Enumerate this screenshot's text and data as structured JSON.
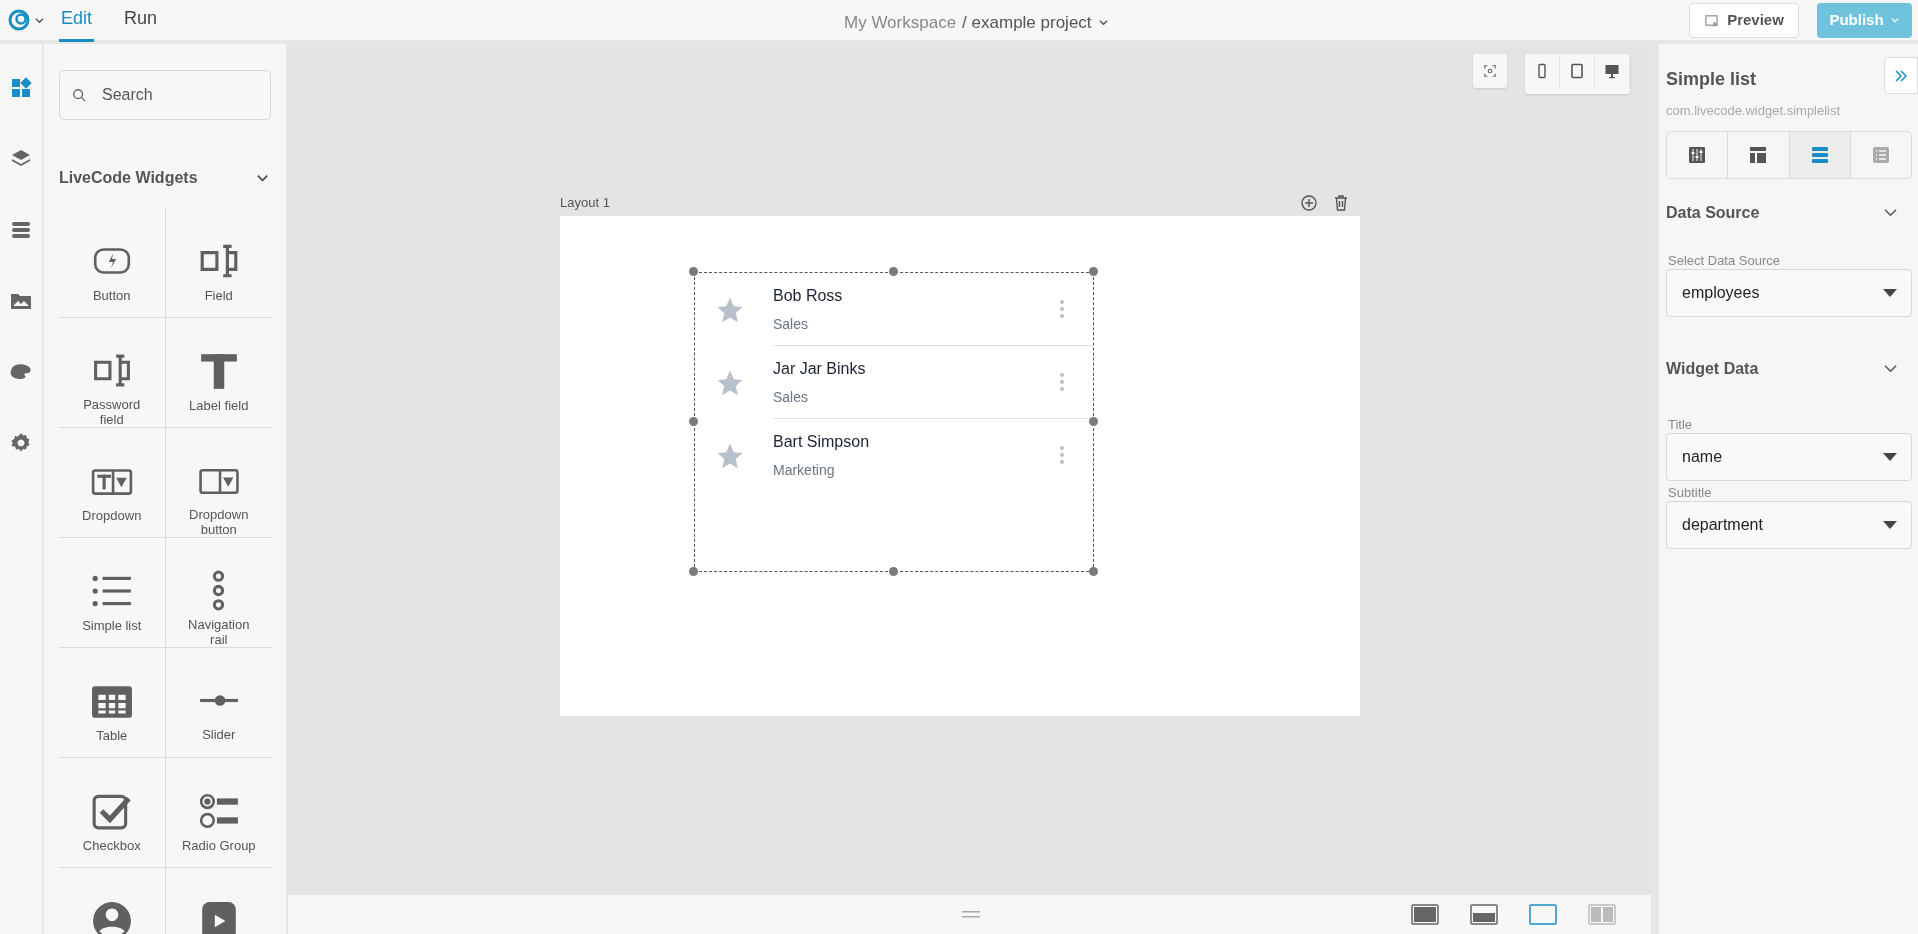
{
  "top_bar": {
    "mode_tabs": [
      {
        "label": "Edit",
        "selected": true
      },
      {
        "label": "Run",
        "selected": false
      }
    ],
    "breadcrumb": {
      "workspace": "My Workspace",
      "project": "/ example project"
    },
    "buttons": [
      {
        "kind": "preview",
        "label": "Preview"
      },
      {
        "kind": "publish",
        "label": "Publish"
      }
    ]
  },
  "rail": [
    {
      "kind": "widgets",
      "selected": true
    },
    {
      "kind": "layers",
      "selected": false
    },
    {
      "kind": "data",
      "selected": false
    },
    {
      "kind": "media",
      "selected": false
    },
    {
      "kind": "themes",
      "selected": false
    },
    {
      "kind": "settings",
      "selected": false
    }
  ],
  "widget_panel": {
    "search": {
      "placeholder": "Search"
    },
    "section": "LiveCode Widgets",
    "widgets": [
      {
        "kind": "button",
        "label": "Button"
      },
      {
        "kind": "field",
        "label": "Field"
      },
      {
        "kind": "password",
        "label": "Password field"
      },
      {
        "kind": "label",
        "label": "Label field"
      },
      {
        "kind": "dropdown",
        "label": "Dropdown"
      },
      {
        "kind": "dropdown_button",
        "label": "Dropdown button"
      },
      {
        "kind": "list",
        "label": "Simple list"
      },
      {
        "kind": "navrail",
        "label": "Navigation rail"
      },
      {
        "kind": "table",
        "label": "Table"
      },
      {
        "kind": "slider",
        "label": "Slider"
      },
      {
        "kind": "checkbox",
        "label": "Checkbox"
      },
      {
        "kind": "radio",
        "label": "Radio Group"
      },
      {
        "kind": "avatar"
      },
      {
        "kind": "video"
      }
    ]
  },
  "canvas": {
    "device_buttons": [
      {
        "kind": "phone"
      },
      {
        "kind": "tablet"
      },
      {
        "kind": "desktop"
      }
    ],
    "layout": {
      "title": "Layout 1",
      "list_items": [
        {
          "title": "Bob Ross",
          "subtitle": "Sales"
        },
        {
          "title": "Jar Jar Binks",
          "subtitle": "Sales"
        },
        {
          "title": "Bart Simpson",
          "subtitle": "Marketing"
        }
      ]
    },
    "view_buttons": [
      {
        "kind": "full",
        "selected": false
      },
      {
        "kind": "bottom",
        "selected": false
      },
      {
        "kind": "empty",
        "selected": true
      },
      {
        "kind": "split",
        "selected": false
      }
    ]
  },
  "inspector": {
    "title": "Simple list",
    "id": "com.livecode.widget.simplelist",
    "tabs": [
      {
        "kind": "properties",
        "selected": false
      },
      {
        "kind": "layout",
        "selected": false
      },
      {
        "kind": "data",
        "selected": true
      },
      {
        "kind": "list",
        "selected": false
      }
    ],
    "sections": [
      {
        "title": "Data Source",
        "fields": [
          {
            "label": "Select Data Source",
            "value": "employees"
          }
        ]
      },
      {
        "title": "Widget Data",
        "fields": [
          {
            "label": "Title",
            "value": "name"
          },
          {
            "label": "Subtitle",
            "value": "department"
          }
        ]
      }
    ]
  }
}
